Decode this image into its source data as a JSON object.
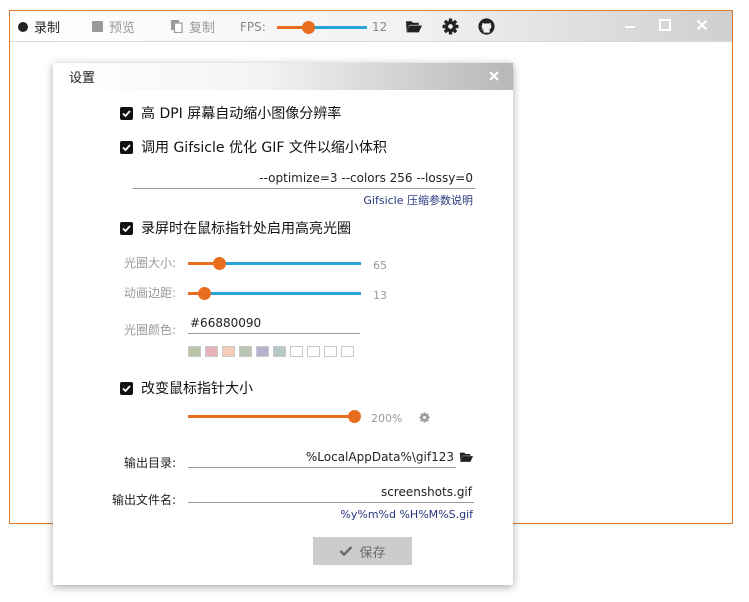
{
  "toolbar": {
    "record_label": "录制",
    "preview_label": "预览",
    "copy_label": "复制",
    "fps_label": "FPS:",
    "fps_value": "12",
    "fps_fraction": 0.35
  },
  "dialog": {
    "title": "设置",
    "opt_highdpi": "高 DPI 屏幕自动缩小图像分辨率",
    "opt_gifsicle": "调用 Gifsicle 优化 GIF 文件以缩小体积",
    "gifsicle_args": "--optimize=3 --colors 256 --lossy=0",
    "gifsicle_link": "Gifsicle 压缩参数说明",
    "opt_halo": "录屏时在鼠标指针处启用高亮光圈",
    "halo_size_label": "光圈大小:",
    "halo_size_value": "65",
    "halo_size_fraction": 0.18,
    "halo_margin_label": "动画边距:",
    "halo_margin_value": "13",
    "halo_margin_fraction": 0.09,
    "halo_color_label": "光圈颜色:",
    "halo_color_value": "#66880090",
    "swatches": [
      "#b8c3aa",
      "#e6b3b8",
      "#f5cbb8",
      "#b9c4b3",
      "#b6b3cf",
      "#b6c8c8",
      "#ffffff",
      "#ffffff",
      "#ffffff",
      "#ffffff"
    ],
    "opt_cursor": "改变鼠标指针大小",
    "cursor_value": "200%",
    "cursor_fraction": 1.0,
    "output_dir_label": "输出目录:",
    "output_dir_value": "%LocalAppData%\\gif123",
    "output_file_label": "输出文件名:",
    "output_file_value": "screenshots.gif",
    "output_file_pattern": "%y%m%d %H%M%S.gif",
    "save_label": "保存"
  },
  "colors": {
    "accent_orange": "#e86d1e",
    "track_blue": "#2aa3d6",
    "link_blue": "#27367c",
    "window_border": "#e07a2a"
  }
}
